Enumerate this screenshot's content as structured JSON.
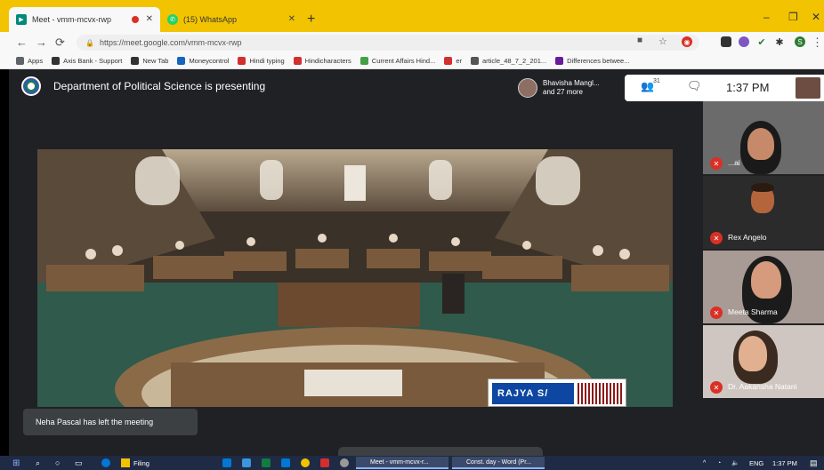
{
  "browser": {
    "tabs": [
      {
        "title": "Meet - vmm-mcvx-rwp",
        "active": true,
        "recording": true
      },
      {
        "title": "(15) WhatsApp",
        "active": false
      }
    ],
    "new_tab": "+",
    "window_controls": {
      "minimize": "–",
      "restore": "❐",
      "close": "✕"
    },
    "url": "https://meet.google.com/vmm-mcvx-rwp",
    "nav": {
      "back": "←",
      "forward": "→",
      "reload": "⟳"
    },
    "bookmarks": [
      {
        "label": "Apps",
        "color": "#5f6368"
      },
      {
        "label": "Axis Bank - Support",
        "color": "#333"
      },
      {
        "label": "New Tab",
        "color": "#333"
      },
      {
        "label": "Moneycontrol",
        "color": "#1565c0"
      },
      {
        "label": "Hindi typing",
        "color": "#d32f2f"
      },
      {
        "label": "Hindicharacters",
        "color": "#d32f2f"
      },
      {
        "label": "Current Affairs Hind...",
        "color": "#43a047"
      },
      {
        "label": "er",
        "color": "#d32f2f"
      },
      {
        "label": "article_48_7_2_201...",
        "color": "#555"
      },
      {
        "label": "Differences betwee...",
        "color": "#6a1b9a"
      }
    ]
  },
  "meet": {
    "presenting_text": "Department of Political Science is presenting",
    "participants_chip": {
      "name": "Bhavisha Mangl...",
      "more": "and 27 more"
    },
    "participant_count": "31",
    "time": "1:37 PM",
    "toast": "Neha Pascal has left the meeting",
    "screen_caption": "RAJYA S/",
    "tiles": [
      {
        "name": "...ai",
        "bg": "#6b6b6b",
        "skin": "#c68a6a",
        "hair": "#1a1a1a"
      },
      {
        "name": "Rex Angelo",
        "bg": "#2b2b2b",
        "skin": "#b5653b",
        "hair": "#2a1a10"
      },
      {
        "name": "Meeta Sharma",
        "bg": "#a89a94",
        "skin": "#d59b7c",
        "hair": "#1b1b1b"
      },
      {
        "name": "Dr. Aakansha Natani",
        "bg": "#cfc6c2",
        "skin": "#e0b090",
        "hair": "#3a2a20"
      }
    ]
  },
  "taskbar": {
    "search_icon": "search-icon",
    "apps": [
      {
        "label": "Filing"
      },
      {
        "label": "Meet - vmm-mcvx-r..."
      },
      {
        "label": "Const. day - Word (Pr..."
      }
    ],
    "tray": {
      "lang": "ENG",
      "time": "1:37 PM"
    }
  },
  "colors": {
    "tab_strip": "#f2c300",
    "meet_bg": "#202124",
    "mic_off": "#d93025"
  }
}
